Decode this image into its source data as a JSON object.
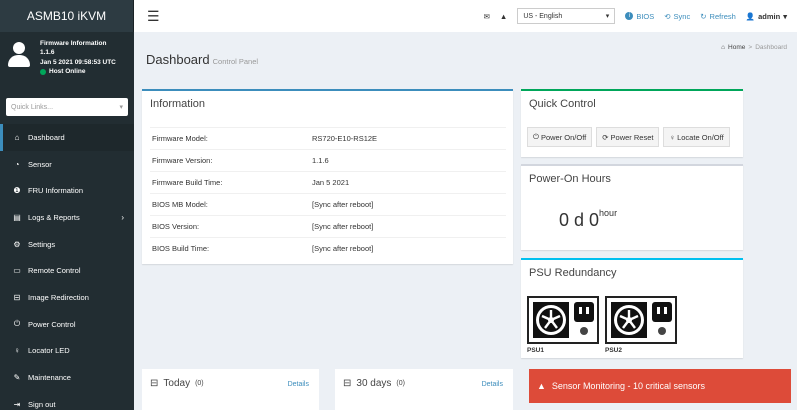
{
  "app": {
    "title": "ASMB10 iKVM"
  },
  "user": {
    "title": "Firmware Information",
    "version": "1.1.6",
    "datetime": "Jan 5 2021 09:58:53 UTC",
    "status": "Host Online"
  },
  "quick_links": {
    "placeholder": "Quick Links..."
  },
  "menu": [
    {
      "label": "Dashboard",
      "icon": "home-icon",
      "glyph": "⌂",
      "active": true
    },
    {
      "label": "Sensor",
      "icon": "gauge-icon",
      "glyph": "◔"
    },
    {
      "label": "FRU Information",
      "icon": "info-icon",
      "glyph": "❶"
    },
    {
      "label": "Logs & Reports",
      "icon": "chart-icon",
      "glyph": "▤",
      "chevron": "›"
    },
    {
      "label": "Settings",
      "icon": "gear-icon",
      "glyph": "⚙"
    },
    {
      "label": "Remote Control",
      "icon": "monitor-icon",
      "glyph": "▭"
    },
    {
      "label": "Image Redirection",
      "icon": "disk-icon",
      "glyph": "⊟"
    },
    {
      "label": "Power Control",
      "icon": "power-icon",
      "glyph": "⏻"
    },
    {
      "label": "Locator LED",
      "icon": "bulb-icon",
      "glyph": "♀"
    },
    {
      "label": "Maintenance",
      "icon": "wrench-icon",
      "glyph": "✎"
    },
    {
      "label": "Sign out",
      "icon": "signout-icon",
      "glyph": "⇥"
    }
  ],
  "header": {
    "language": "US - English",
    "bios": "BIOS",
    "sync": "Sync",
    "refresh": "Refresh",
    "user": "admin"
  },
  "page": {
    "title": "Dashboard",
    "subtitle": "Control Panel"
  },
  "breadcrumb": {
    "home": "Home",
    "separator": ">",
    "current": "Dashboard"
  },
  "information": {
    "title": "Information",
    "rows": [
      {
        "key": "Firmware Model:",
        "value": "RS720-E10-RS12E"
      },
      {
        "key": "Firmware Version:",
        "value": "1.1.6"
      },
      {
        "key": "Firmware Build Time:",
        "value": "Jan 5 2021"
      },
      {
        "key": "BIOS MB Model:",
        "value": "[Sync after reboot]"
      },
      {
        "key": "BIOS Version:",
        "value": "[Sync after reboot]"
      },
      {
        "key": "BIOS Build Time:",
        "value": "[Sync after reboot]"
      }
    ]
  },
  "quick_control": {
    "title": "Quick Control",
    "buttons": [
      "Power On/Off",
      "Power Reset",
      "Locate On/Off"
    ]
  },
  "power_on_hours": {
    "title": "Power-On Hours",
    "value": "0 d 0",
    "unit": "hour"
  },
  "psu": {
    "title": "PSU Redundancy",
    "units": [
      "PSU1",
      "PSU2"
    ]
  },
  "today": {
    "title": "Today",
    "count": "(0)",
    "details": "Details"
  },
  "days30": {
    "title": "30 days",
    "count": "(0)",
    "details": "Details"
  },
  "alert": {
    "text": "Sensor Monitoring - 10 critical sensors"
  },
  "colors": {
    "sidebar": "#222d32",
    "primary": "#3c8dbc",
    "success": "#00a65a",
    "danger": "#dd4b39"
  }
}
